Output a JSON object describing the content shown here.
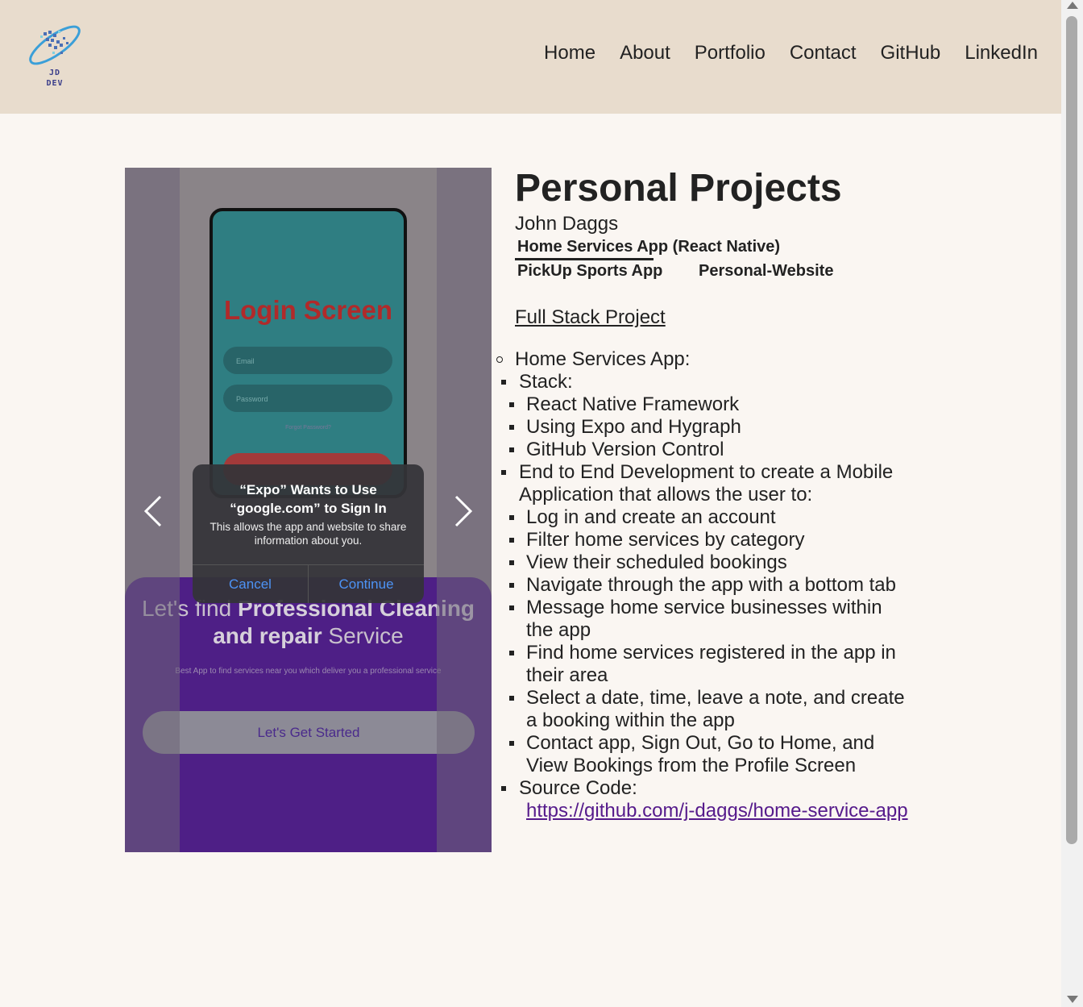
{
  "header": {
    "logo_text_line1": "JD",
    "logo_text_line2": "DEV",
    "nav": [
      "Home",
      "About",
      "Portfolio",
      "Contact",
      "GitHub",
      "LinkedIn"
    ]
  },
  "carousel": {
    "login_title": "Login Screen",
    "email_placeholder": "Email",
    "password_placeholder": "Password",
    "forgot": "Forgot Password?",
    "dialog": {
      "title_line1": "“Expo” Wants to Use",
      "title_line2": "“google.com” to Sign In",
      "message": "This allows the app and website to share information about you.",
      "cancel": "Cancel",
      "continue": "Continue"
    },
    "promo_part1": "Let's find ",
    "promo_bold": "Professional Cleaning and repair",
    "promo_part2": " Service",
    "promo_sub": "Best App to find services near you which deliver you a professional service",
    "start_button": "Let's Get Started"
  },
  "main": {
    "title": "Personal Projects",
    "author": "John Daggs",
    "tabs": [
      "Home Services App (React Native)",
      "PickUp Sports App",
      "Personal-Website"
    ],
    "subheading": "Full Stack Project",
    "project_name": "Home Services App:",
    "stack_label": "Stack:",
    "stack_items": [
      "React Native Framework",
      "Using Expo and Hygraph",
      "GitHub Version Control"
    ],
    "e2e_line1": "End to End Development to create a Mobile",
    "e2e_line2": "Application that allows the user to:",
    "features": [
      "Log in and create an account",
      "Filter home services by category",
      "View their scheduled bookings",
      "Navigate through the app with a bottom tab",
      "Message home service businesses within",
      "the app",
      "Find home services registered in the app in",
      "their area",
      "Select a date, time, leave a note, and create",
      "a booking within the app",
      "Contact app, Sign Out, Go to Home, and",
      "View Bookings from the Profile Screen"
    ],
    "source_label": "Source Code:",
    "source_url": "https://github.com/j-daggs/home-service-app"
  }
}
